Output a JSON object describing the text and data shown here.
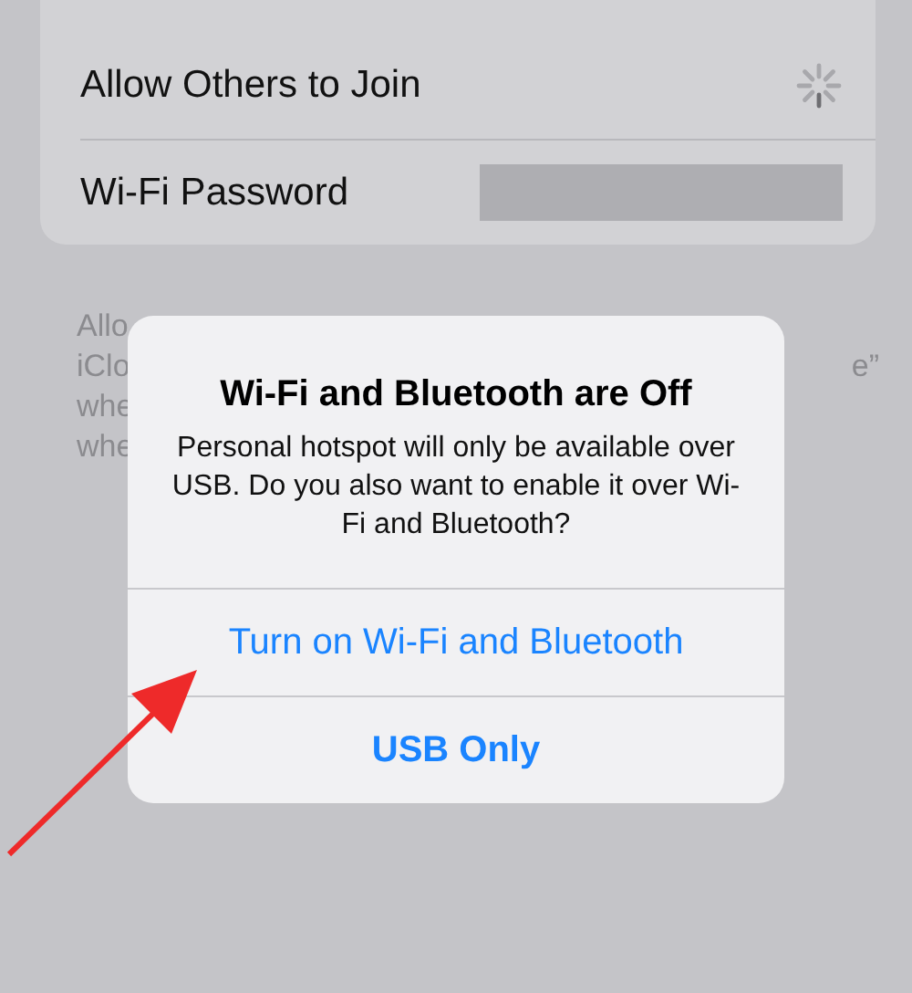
{
  "settings": [
    {
      "label": "Allow Others to Join",
      "kind": "spinner"
    },
    {
      "label": "Wi-Fi Password",
      "kind": "hidden-value"
    }
  ],
  "footer_lines": [
    {
      "left": "Allo"
    },
    {
      "left": "iClo",
      "right": "e”"
    },
    {
      "left": "whe"
    },
    {
      "left": "whe"
    }
  ],
  "alert": {
    "title": "Wi-Fi and Bluetooth are Off",
    "message": "Personal hotspot will only be available over USB. Do you also want to enable it over Wi-Fi and Bluetooth?",
    "buttons": [
      {
        "label": "Turn on Wi-Fi and Bluetooth",
        "kind": "default"
      },
      {
        "label": "USB Only",
        "kind": "bold"
      }
    ]
  }
}
